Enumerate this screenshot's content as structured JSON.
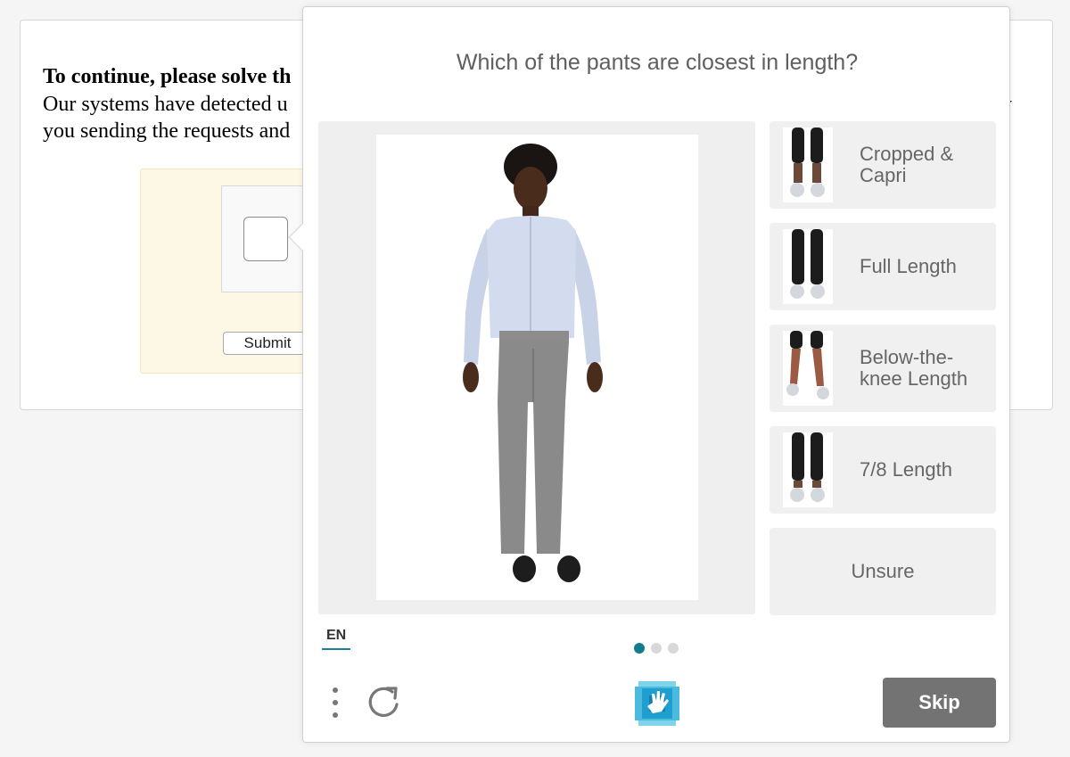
{
  "page": {
    "heading": "To continue, please solve th",
    "line1": "Our systems have detected u",
    "line2": "you sending the requests and",
    "edge_char": "y",
    "submit_label": "Submit"
  },
  "challenge": {
    "prompt": "Which of the pants are closest in length?",
    "options": [
      {
        "label": "Cropped & Capri"
      },
      {
        "label": "Full Length"
      },
      {
        "label": "Below-the-knee Length"
      },
      {
        "label": "7/8 Length"
      },
      {
        "label": "Unsure"
      }
    ],
    "language": "EN",
    "pagination": {
      "total": 3,
      "current": 1
    },
    "skip_label": "Skip"
  },
  "colors": {
    "accent": "#107e8f",
    "skip_button": "#737373",
    "option_bg": "#f0f0f0",
    "captcha_frame": "#fdf8e6"
  },
  "icons": {
    "menu": "vertical-dots-icon",
    "refresh": "refresh-icon",
    "brand": "hand-logo-icon"
  }
}
